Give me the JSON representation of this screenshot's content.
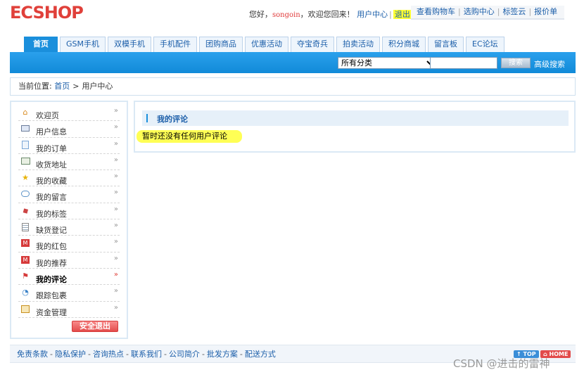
{
  "header": {
    "logo_text": "ECSHOP",
    "greeting": "您好，",
    "username": "songoin",
    "welcome_back": "，欢迎您回来！",
    "user_center": "用户中心",
    "separator": "|",
    "logout": "退出",
    "top_links": [
      "查看购物车",
      "选购中心",
      "标签云",
      "报价单"
    ]
  },
  "nav": {
    "tabs": [
      "首页",
      "GSM手机",
      "双模手机",
      "手机配件",
      "团购商品",
      "优惠活动",
      "夺宝奇兵",
      "拍卖活动",
      "积分商城",
      "留言板",
      "EC论坛"
    ],
    "active_index": 0
  },
  "search": {
    "category_selected": "所有分类",
    "keyword": "",
    "button_label": "搜索",
    "advanced_label": "高级搜索"
  },
  "breadcrumb": {
    "prefix": "当前位置:",
    "home": "首页",
    "gt": ">",
    "current": "用户中心"
  },
  "sidebar": {
    "items": [
      {
        "label": "欢迎页",
        "icon": "home-icon"
      },
      {
        "label": "用户信息",
        "icon": "user-card-icon"
      },
      {
        "label": "我的订单",
        "icon": "order-doc-icon"
      },
      {
        "label": "收货地址",
        "icon": "address-icon"
      },
      {
        "label": "我的收藏",
        "icon": "star-icon"
      },
      {
        "label": "我的留言",
        "icon": "message-bubble-icon"
      },
      {
        "label": "我的标签",
        "icon": "tag-icon"
      },
      {
        "label": "缺货登记",
        "icon": "list-icon"
      },
      {
        "label": "我的红包",
        "icon": "red-packet-icon"
      },
      {
        "label": "我的推荐",
        "icon": "recommend-icon"
      },
      {
        "label": "我的评论",
        "icon": "flag-icon"
      },
      {
        "label": "跟踪包裹",
        "icon": "track-icon"
      },
      {
        "label": "资金管理",
        "icon": "money-icon"
      }
    ],
    "active_index": 10,
    "chevron": "»",
    "logout_button": "安全退出"
  },
  "main": {
    "title": "我的评论",
    "empty_message": "暂时还没有任何用户评论"
  },
  "footer": {
    "links": [
      "免责条款",
      "隐私保护",
      "咨询热点",
      "联系我们",
      "公司简介",
      "批发方案",
      "配送方式"
    ],
    "dash": "-",
    "top_badge": "↑ TOP",
    "home_badge": "⌂ HOME"
  },
  "watermark": "CSDN @进击的雷神",
  "colors": {
    "accent_blue": "#1a8fdc",
    "link_blue": "#1b5ea9",
    "highlight_yellow": "#ffff55",
    "logout_red": "#e34c4c"
  }
}
